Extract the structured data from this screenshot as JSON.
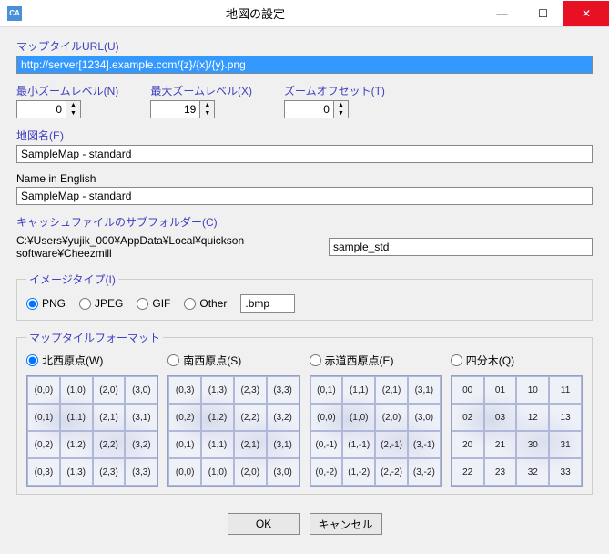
{
  "titlebar": {
    "title": "地図の設定",
    "icon": "CA"
  },
  "url": {
    "label": "マップタイルURL(U)",
    "value": "http://server[1234].example.com/{z}/{x}/{y}.png"
  },
  "zoom": {
    "min": {
      "label": "最小ズームレベル(N)",
      "value": "0"
    },
    "max": {
      "label": "最大ズームレベル(X)",
      "value": "19"
    },
    "offset": {
      "label": "ズームオフセット(T)",
      "value": "0"
    }
  },
  "mapname": {
    "label": "地図名(E)",
    "value": "SampleMap - standard"
  },
  "english": {
    "label": "Name in English",
    "value": "SampleMap - standard"
  },
  "cache": {
    "label": "キャッシュファイルのサブフォルダー(C)",
    "path": "C:¥Users¥yujik_000¥AppData¥Local¥quickson software¥Cheezmill",
    "value": "sample_std"
  },
  "imagetype": {
    "legend": "イメージタイプ(I)",
    "png": "PNG",
    "jpeg": "JPEG",
    "gif": "GIF",
    "other": "Other",
    "other_value": ".bmp"
  },
  "format": {
    "legend": "マップタイルフォーマット",
    "nw": {
      "label": "北西原点(W)",
      "cells": [
        "(0,0)",
        "(1,0)",
        "(2,0)",
        "(3,0)",
        "(0,1)",
        "(1,1)",
        "(2,1)",
        "(3,1)",
        "(0,2)",
        "(1,2)",
        "(2,2)",
        "(3,2)",
        "(0,3)",
        "(1,3)",
        "(2,3)",
        "(3,3)"
      ]
    },
    "sw": {
      "label": "南西原点(S)",
      "cells": [
        "(0,3)",
        "(1,3)",
        "(2,3)",
        "(3,3)",
        "(0,2)",
        "(1,2)",
        "(2,2)",
        "(3,2)",
        "(0,1)",
        "(1,1)",
        "(2,1)",
        "(3,1)",
        "(0,0)",
        "(1,0)",
        "(2,0)",
        "(3,0)"
      ]
    },
    "eq": {
      "label": "赤道西原点(E)",
      "cells": [
        "(0,1)",
        "(1,1)",
        "(2,1)",
        "(3,1)",
        "(0,0)",
        "(1,0)",
        "(2,0)",
        "(3,0)",
        "(0,-1)",
        "(1,-1)",
        "(2,-1)",
        "(3,-1)",
        "(0,-2)",
        "(1,-2)",
        "(2,-2)",
        "(3,-2)"
      ]
    },
    "qt": {
      "label": "四分木(Q)",
      "cells": [
        "00",
        "01",
        "10",
        "11",
        "02",
        "03",
        "12",
        "13",
        "20",
        "21",
        "30",
        "31",
        "22",
        "23",
        "32",
        "33"
      ]
    }
  },
  "buttons": {
    "ok": "OK",
    "cancel": "キャンセル"
  }
}
